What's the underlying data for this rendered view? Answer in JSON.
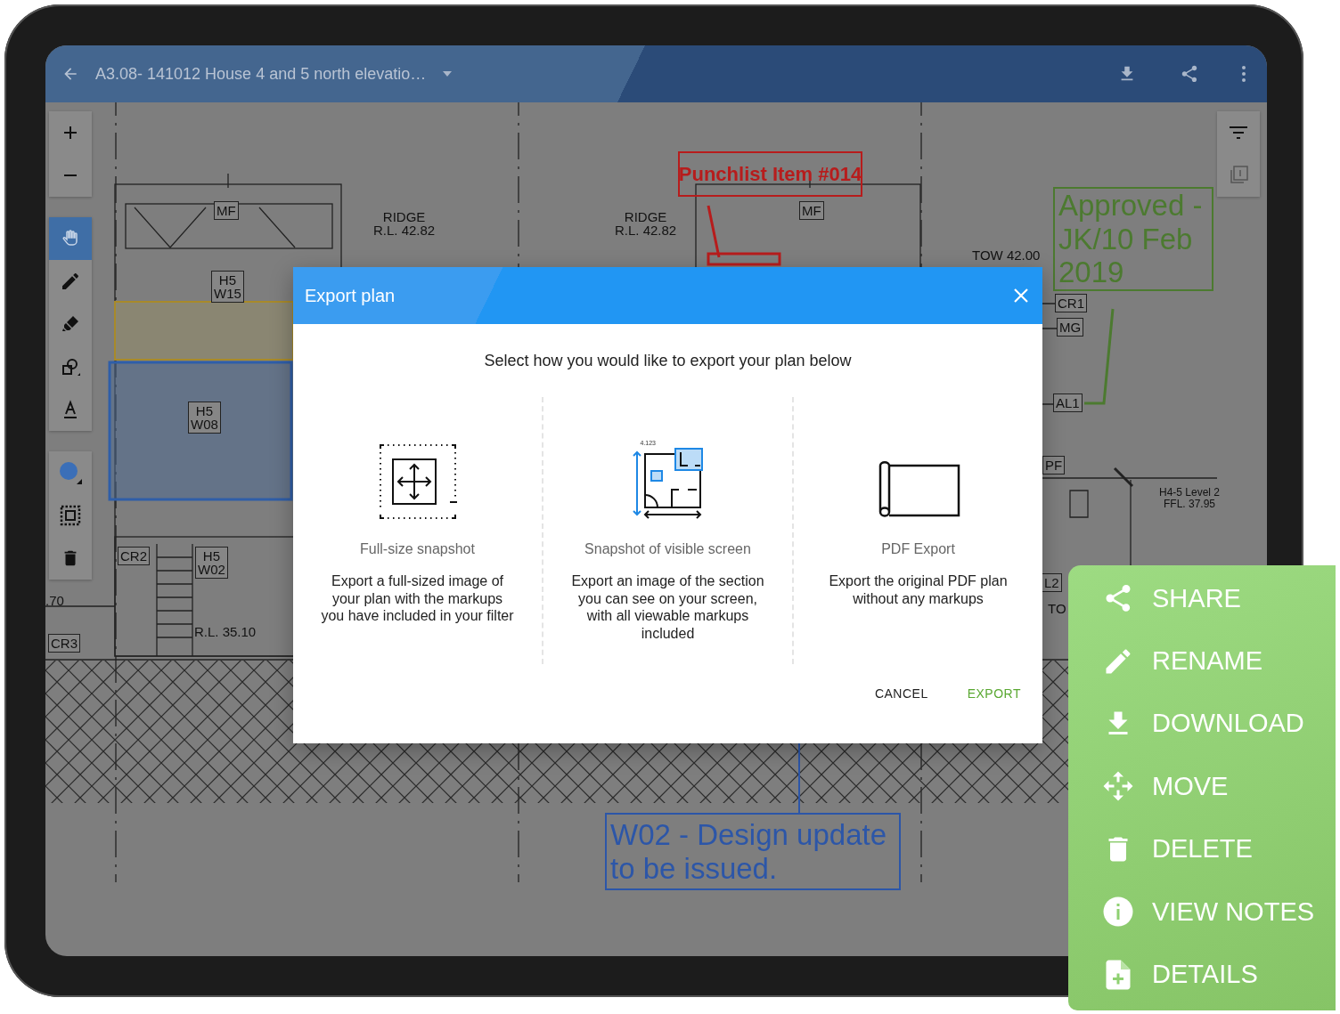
{
  "top_bar": {
    "title": "A3.08- 141012 House 4 and 5 north elevatio…"
  },
  "left_toolbar": {
    "tools": [
      {
        "kind": "hand",
        "selected": true
      },
      {
        "kind": "pen",
        "selected": false
      },
      {
        "kind": "highlighter",
        "selected": false
      },
      {
        "kind": "shapes",
        "selected": false
      },
      {
        "kind": "text",
        "selected": false
      }
    ]
  },
  "plan": {
    "labels": [
      {
        "kind": "tag",
        "text": "MF"
      },
      {
        "kind": "plain",
        "text": "RIDGE\nR.L. 42.82"
      },
      {
        "kind": "plain",
        "text": "RIDGE\nR.L. 42.82"
      },
      {
        "kind": "tag",
        "text": "MF"
      },
      {
        "kind": "tag",
        "text": "H5\nW15"
      },
      {
        "kind": "tag",
        "text": "H5\nW08"
      },
      {
        "kind": "tag",
        "text": "CR2"
      },
      {
        "kind": "tag",
        "text": "H5\nW02"
      },
      {
        "kind": "plain",
        "text": "R.L. 35.10"
      },
      {
        "kind": "plain",
        "text": ".70"
      },
      {
        "kind": "tag",
        "text": "CR3"
      },
      {
        "kind": "plain",
        "text": "TOW 42.00"
      },
      {
        "kind": "tag",
        "text": "CR1"
      },
      {
        "kind": "tag",
        "text": "MG"
      },
      {
        "kind": "tag",
        "text": "AL1"
      },
      {
        "kind": "tag",
        "text": "PF"
      },
      {
        "kind": "small",
        "text": "H4-5 Level 2\nFFL. 37.95"
      },
      {
        "kind": "tag",
        "text": "L2"
      },
      {
        "kind": "plain",
        "text": "TO"
      }
    ],
    "markups": [
      {
        "kind": "punchlist",
        "text": "Punchlist Item #014",
        "color": "#b71c1c"
      },
      {
        "kind": "approval",
        "text": "Approved - JK/10 Feb 2019",
        "color": "#4c7a30"
      },
      {
        "kind": "note",
        "text": "W02 - Design update to be issued.",
        "color": "#2c56a8"
      }
    ]
  },
  "dialog": {
    "title": "Export plan",
    "prompt": "Select how you would like to export your plan below",
    "options": [
      {
        "kind": "full-size",
        "title": "Full-size snapshot",
        "description": "Export a full-sized image of your plan with the markups you have included in your filter"
      },
      {
        "kind": "visible",
        "title": "Snapshot of visible screen",
        "description": "Export an image of the section you can see on your screen, with all viewable markups included",
        "dimension_label": "4.123"
      },
      {
        "kind": "pdf",
        "title": "PDF Export",
        "description": "Export the original PDF plan without any markups"
      }
    ],
    "actions": [
      {
        "label": "CANCEL",
        "primary": false
      },
      {
        "label": "EXPORT",
        "primary": true
      }
    ]
  },
  "context_menu": {
    "items": [
      {
        "kind": "share",
        "label": "SHARE"
      },
      {
        "kind": "rename",
        "label": "RENAME"
      },
      {
        "kind": "download",
        "label": "DOWNLOAD"
      },
      {
        "kind": "move",
        "label": "MOVE"
      },
      {
        "kind": "delete",
        "label": "DELETE"
      },
      {
        "kind": "notes",
        "label": "VIEW NOTES"
      },
      {
        "kind": "details",
        "label": "DETAILS"
      }
    ]
  }
}
